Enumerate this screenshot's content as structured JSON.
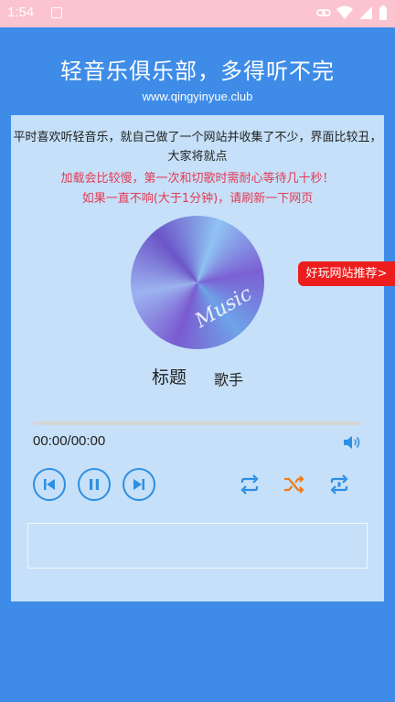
{
  "status_bar": {
    "time": "1:54",
    "app_icon": "font-icon",
    "right_icons": [
      "link-icon",
      "wifi-icon",
      "signal-icon",
      "battery-icon"
    ]
  },
  "header": {
    "title": "轻音乐俱乐部，多得听不完",
    "url": "www.qingyinyue.club"
  },
  "intro": {
    "text": "平时喜欢听轻音乐，就自己做了一个网站并收集了不少，界面比较丑，大家将就点",
    "warning1": "加载会比较慢，第一次和切歌时需耐心等待几十秒！",
    "warning2": "如果一直不响(大于1分钟)，请刷新一下网页"
  },
  "disc": {
    "label": "Music"
  },
  "promo": {
    "label": "好玩网站推荐>"
  },
  "track": {
    "title": "标题",
    "artist": "歌手"
  },
  "player": {
    "progress": 0,
    "time": "00:00/00:00",
    "controls": [
      "previous-icon",
      "pause-icon",
      "next-icon"
    ],
    "modes": [
      "repeat-icon",
      "shuffle-icon",
      "repeat-one-icon"
    ]
  },
  "colors": {
    "status_bar": "#fbc4cf",
    "header_bg": "#3e8ce8",
    "card_bg": "#c5e0f8",
    "warning": "#e43a55",
    "accent": "#2d8fe3",
    "shuffle": "#f07a1a",
    "promo_bg": "#ee1d1d"
  }
}
